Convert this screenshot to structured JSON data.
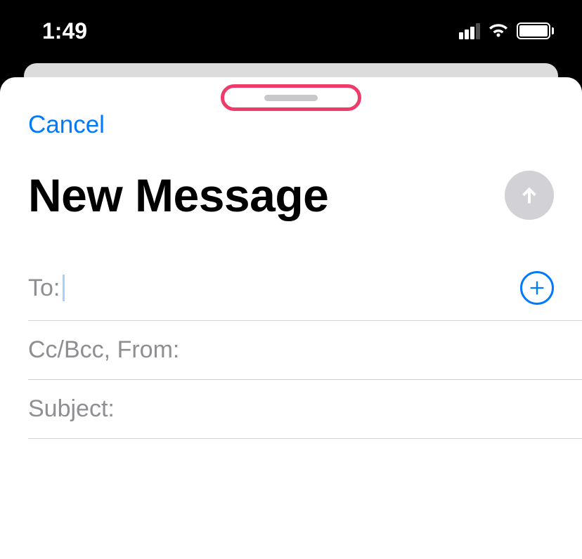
{
  "status": {
    "time": "1:49"
  },
  "sheet": {
    "cancel_label": "Cancel",
    "title": "New Message",
    "fields": {
      "to_label": "To:",
      "to_value": "",
      "ccbcc_label": "Cc/Bcc, From:",
      "ccbcc_value": "",
      "subject_label": "Subject:",
      "subject_value": ""
    }
  }
}
